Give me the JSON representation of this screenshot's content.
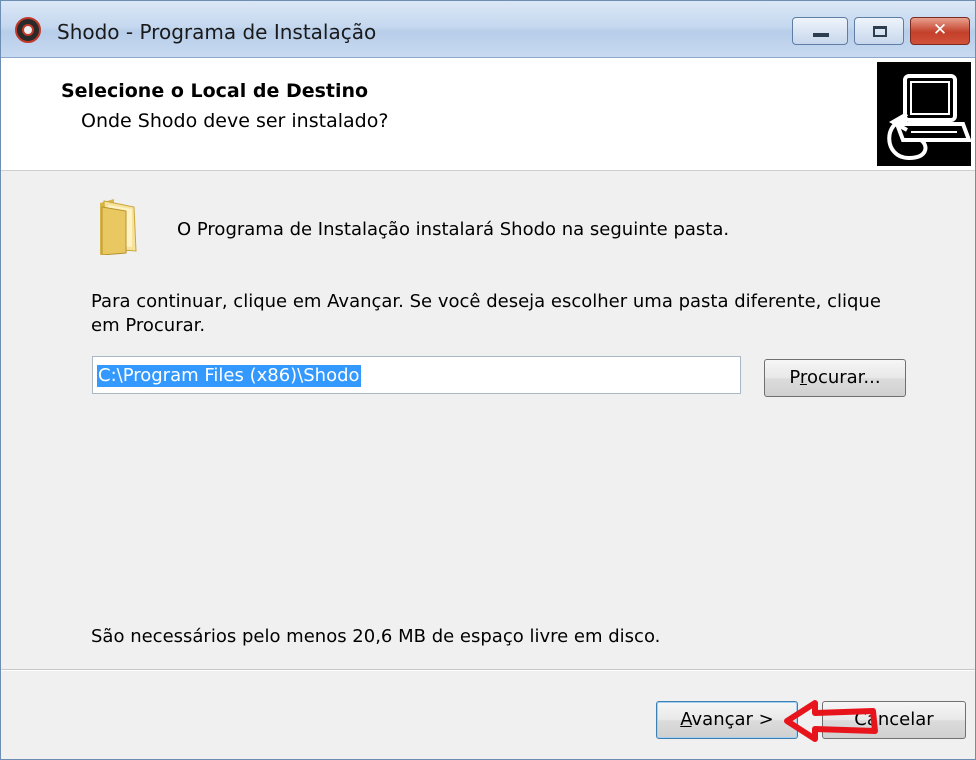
{
  "window": {
    "title": "Shodo - Programa de Instalação",
    "controls": {
      "minimize": "minimize-icon",
      "maximize": "maximize-icon",
      "close": "close-icon"
    }
  },
  "header": {
    "title": "Selecione o Local de Destino",
    "subtitle": "Onde Shodo deve ser instalado?"
  },
  "body": {
    "intro": "O Programa de Instalação instalará Shodo na seguinte pasta.",
    "instructions": "Para continuar, clique em Avançar. Se você deseja escolher uma pasta diferente, clique em Procurar.",
    "path_value": "C:\\Program Files (x86)\\Shodo",
    "browse_label_ul": "r",
    "browse_label_pre": "P",
    "browse_label_post": "ocurar...",
    "space_note": "São necessários pelo menos 20,6 MB de espaço livre em disco."
  },
  "footer": {
    "next_ul": "A",
    "next_post": "vançar >",
    "cancel_label": "Cancelar"
  },
  "colors": {
    "selection": "#3399ff",
    "annotation_arrow": "#e8141c"
  }
}
